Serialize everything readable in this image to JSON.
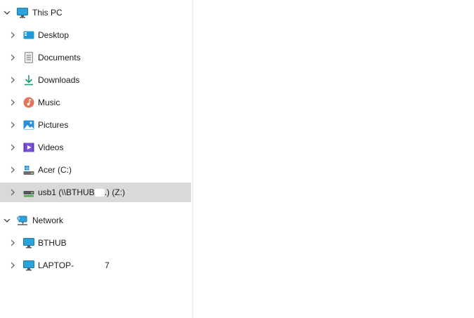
{
  "tree": {
    "this_pc": {
      "label": "This PC",
      "expanded": true,
      "icon": "monitor-icon"
    },
    "pc_children": [
      {
        "label": "Desktop",
        "icon": "desktop-folder-icon"
      },
      {
        "label": "Documents",
        "icon": "documents-icon"
      },
      {
        "label": "Downloads",
        "icon": "download-arrow-icon"
      },
      {
        "label": "Music",
        "icon": "music-icon"
      },
      {
        "label": "Pictures",
        "icon": "pictures-icon"
      },
      {
        "label": "Videos",
        "icon": "videos-icon"
      },
      {
        "label": "Acer (C:)",
        "icon": "drive-icon"
      },
      {
        "label": "usb1 (\\\\BTHUB",
        "label_suffix": ".) (Z:)",
        "icon": "network-drive-icon",
        "selected": true
      }
    ],
    "network": {
      "label": "Network",
      "expanded": true,
      "icon": "network-icon"
    },
    "network_children": [
      {
        "label": "BTHUB",
        "icon": "computer-icon"
      },
      {
        "label": "LAPTOP-",
        "label_suffix": "7",
        "icon": "computer-icon"
      }
    ]
  },
  "colors": {
    "selected_bg": "#d9d9d9",
    "monitor_blue": "#2aa3d8",
    "download_green": "#1a9e6e"
  }
}
